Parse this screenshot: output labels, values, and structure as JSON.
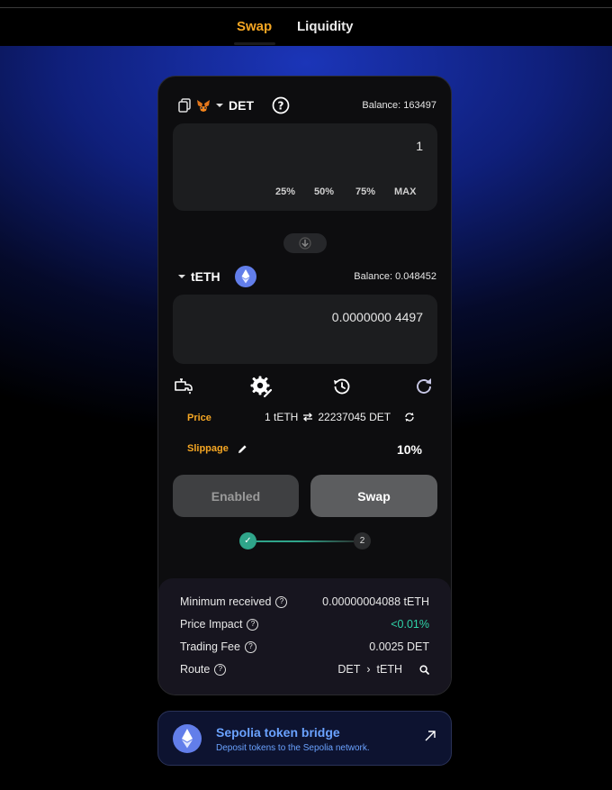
{
  "nav": {
    "tabs": [
      {
        "label": "Swap"
      },
      {
        "label": "Liquidity"
      }
    ]
  },
  "from": {
    "token": "DET",
    "balance": "Balance: 163497",
    "amount": "1",
    "pct": [
      "25%",
      "50%",
      "75%",
      "MAX"
    ]
  },
  "to": {
    "token": "tETH",
    "balance": "Balance: 0.048452",
    "amount": "0.0000000 4497"
  },
  "price": {
    "label": "Price",
    "value_left": "1 tETH",
    "value_right": "22237045 DET"
  },
  "slippage": {
    "label": "Slippage",
    "value": "10%"
  },
  "buttons": {
    "enabled": "Enabled",
    "swap": "Swap"
  },
  "steps": {
    "step1": "✓",
    "step2": "2"
  },
  "details": {
    "min_received_label": "Minimum received",
    "min_received_value": "0.00000004088 tETH",
    "price_impact_label": "Price Impact",
    "price_impact_value": "<0.01%",
    "trading_fee_label": "Trading Fee",
    "trading_fee_value": "0.0025 DET",
    "route_label": "Route",
    "route_from": "DET",
    "route_sep": "›",
    "route_to": "tETH"
  },
  "bridge": {
    "title": "Sepolia token bridge",
    "subtitle": "Deposit tokens to the Sepolia network."
  },
  "colors": {
    "accent": "#f5a623",
    "success": "#2fd3a8",
    "link": "#6aa2ff",
    "eth": "#627eea"
  },
  "icons": [
    "copy-icon",
    "metamask-fox-icon",
    "caret-down-icon",
    "help-icon",
    "arrow-down-icon",
    "ethereum-icon",
    "faucet-icon",
    "settings-gear-icon",
    "history-icon",
    "refresh-icon",
    "swap-arrows-icon",
    "pencil-icon",
    "search-icon",
    "external-arrow-icon"
  ]
}
